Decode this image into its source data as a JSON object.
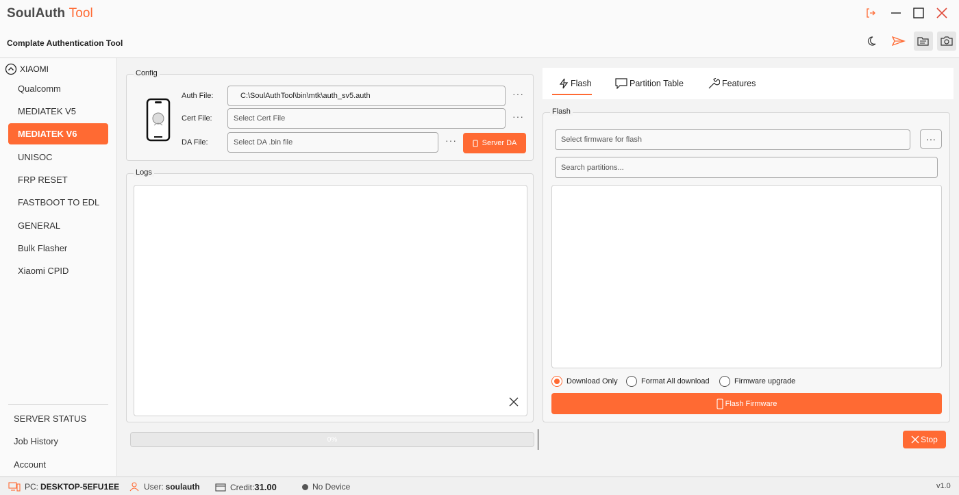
{
  "header": {
    "title_main": "SoulAuth",
    "title_accent": "Tool",
    "subtitle": "Complate Authentication Tool",
    "window_buttons": [
      "logout-icon",
      "minimize-icon",
      "maximize-icon",
      "close-icon"
    ],
    "toolbar_icons": [
      "moon-icon",
      "send-icon",
      "folder-icon",
      "camera-icon"
    ]
  },
  "sidebar": {
    "brand": "XIAOMI",
    "items": [
      {
        "label": "Qualcomm"
      },
      {
        "label": "MEDIATEK V5"
      },
      {
        "label": "MEDIATEK V6",
        "active": true
      },
      {
        "label": "UNISOC"
      },
      {
        "label": "FRP RESET"
      },
      {
        "label": "FASTBOOT TO EDL"
      },
      {
        "label": "GENERAL"
      },
      {
        "label": "Bulk Flasher"
      },
      {
        "label": "Xiaomi CPID"
      }
    ],
    "bottom_items": [
      {
        "label": "SERVER STATUS"
      },
      {
        "label": "Job History"
      },
      {
        "label": "Account"
      }
    ]
  },
  "config": {
    "title": "Config",
    "auth_label": "Auth File:",
    "auth_value": "C:\\SoulAuthTool\\bin\\mtk\\auth_sv5.auth",
    "cert_label": "Cert File:",
    "cert_placeholder": "Select Cert File",
    "da_label": "DA File:",
    "da_placeholder": "Select DA .bin file",
    "more": "···",
    "server_da_label": "Server DA"
  },
  "logs": {
    "title": "Logs"
  },
  "progress": {
    "percent_text": "0%",
    "value": 0
  },
  "tabs": [
    {
      "label": "Flash",
      "icon": "lightning-icon",
      "active": true
    },
    {
      "label": "Partition Table",
      "icon": "chat-icon"
    },
    {
      "label": "Features",
      "icon": "wrench-icon"
    }
  ],
  "flash": {
    "title": "Flash",
    "firmware_placeholder": "Select firmware for flash",
    "more": "···",
    "search_placeholder": "Search partitions...",
    "options": [
      {
        "label": "Download Only",
        "selected": true
      },
      {
        "label": "Format All download",
        "selected": false
      },
      {
        "label": "Firmware upgrade",
        "selected": false
      }
    ],
    "flash_button": "Flash Firmware",
    "stop_button": "Stop"
  },
  "status": {
    "pc_label": "PC:",
    "pc_value": "DESKTOP-5EFU1EE",
    "user_label": "User:",
    "user_value": "soulauth",
    "credit_label": "Credit:",
    "credit_value": "31.00",
    "device": "No Device",
    "version": "v1.0"
  },
  "colors": {
    "accent": "#ff6a33"
  }
}
